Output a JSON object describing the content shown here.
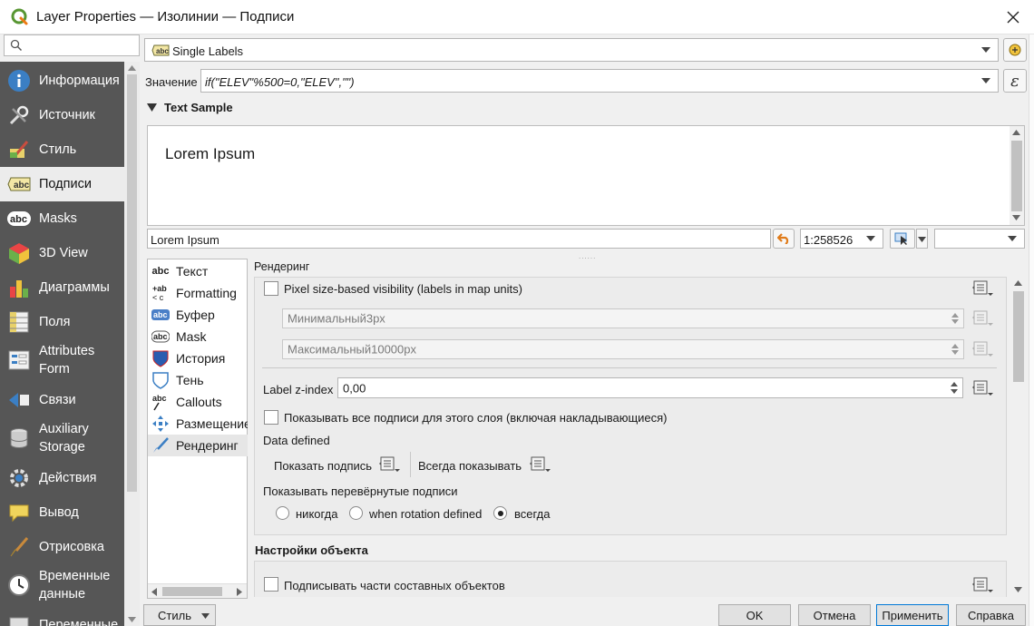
{
  "window": {
    "title": "Layer Properties — Изолинии — Подписи"
  },
  "sidebar": {
    "items": [
      {
        "label": "Информация",
        "icon": "info-icon"
      },
      {
        "label": "Источник",
        "icon": "source-tools-icon"
      },
      {
        "label": "Стиль",
        "icon": "style-brush-icon"
      },
      {
        "label": "Подписи",
        "icon": "labels-abc-icon"
      },
      {
        "label": "Masks",
        "icon": "masks-abc-icon"
      },
      {
        "label": "3D View",
        "icon": "cube-3d-icon"
      },
      {
        "label": "Диаграммы",
        "icon": "diagrams-icon"
      },
      {
        "label": "Поля",
        "icon": "fields-icon"
      },
      {
        "label": "Attributes Form",
        "icon": "form-icon"
      },
      {
        "label": "Связи",
        "icon": "joins-icon"
      },
      {
        "label": "Auxiliary Storage",
        "icon": "database-icon"
      },
      {
        "label": "Действия",
        "icon": "actions-gear-icon"
      },
      {
        "label": "Вывод",
        "icon": "display-bubble-icon"
      },
      {
        "label": "Отрисовка",
        "icon": "rendering-brush-icon"
      },
      {
        "label": "Временные данные",
        "icon": "temporal-clock-icon"
      },
      {
        "label": "Переменные",
        "icon": "variables-icon"
      }
    ]
  },
  "label_mode": {
    "value": "Single Labels"
  },
  "value_row": {
    "label": "Значение",
    "expression": "if(\"ELEV\"%500=0,\"ELEV\",\"\")"
  },
  "text_sample": {
    "header": "Text Sample",
    "preview": "Lorem Ipsum",
    "input": "Lorem Ipsum",
    "scale": "1:258526"
  },
  "tree": {
    "items": [
      {
        "label": "Текст",
        "icon": "abc-text-icon"
      },
      {
        "label": "Formatting",
        "icon": "abc-formatting-icon"
      },
      {
        "label": "Буфер",
        "icon": "abc-buffer-icon"
      },
      {
        "label": "Mask",
        "icon": "abc-mask-icon"
      },
      {
        "label": "История",
        "icon": "background-shield-icon"
      },
      {
        "label": "Тень",
        "icon": "shadow-icon"
      },
      {
        "label": "Callouts",
        "icon": "callouts-icon"
      },
      {
        "label": "Размещение",
        "icon": "placement-icon"
      },
      {
        "label": "Рендеринг",
        "icon": "rendering-icon"
      }
    ]
  },
  "rendering": {
    "section_title": "Рендеринг",
    "pixel_visibility_label": "Pixel size-based visibility (labels in map units)",
    "min_value": "Минимальный3px",
    "max_value": "Максимальный10000px",
    "zindex_label": "Label z-index",
    "zindex_value": "0,00",
    "show_all_label": "Показывать все подписи для этого слоя (включая накладывающиеся)",
    "data_defined_label": "Data defined",
    "show_label": "Показать подпись",
    "always_show": "Всегда показывать",
    "upside_label": "Показывать перевёрнутые подписи",
    "upside_options": [
      "никогда",
      "when rotation defined",
      "всегда"
    ],
    "upside_selected": 2
  },
  "feature_options": {
    "title": "Настройки объекта",
    "label_parts": "Подписывать части составных объектов"
  },
  "footer": {
    "style_label": "Стиль",
    "ok": "OK",
    "cancel": "Отмена",
    "apply": "Применить",
    "help": "Справка"
  }
}
